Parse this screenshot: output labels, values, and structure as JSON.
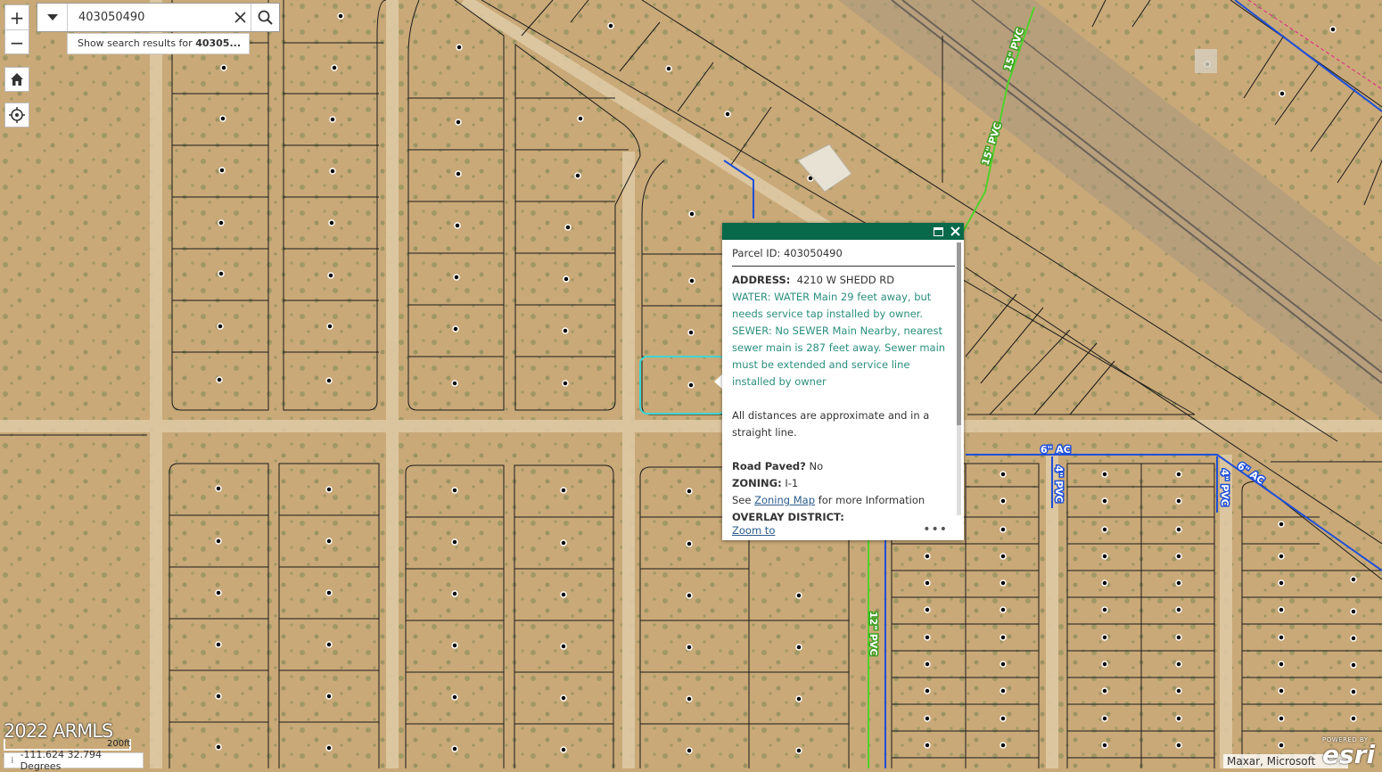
{
  "search": {
    "value": "403050490",
    "suggestion_prefix": "Show search results for ",
    "suggestion_query": "40305..."
  },
  "zoom": {
    "in_label": "+",
    "out_label": "−"
  },
  "icons": {
    "zoom_in": "plus-icon",
    "zoom_out": "minus-icon",
    "home": "home-icon",
    "locate": "locate-icon",
    "dropdown": "caret-down-icon",
    "clear": "close-icon",
    "search": "search-icon",
    "maximize": "maximize-icon",
    "close": "close-icon",
    "more": "more-icon"
  },
  "popup": {
    "title": "Parcel ID: 403050490",
    "address_label": "ADDRESS:",
    "address_value": "4210 W SHEDD RD",
    "water_text": "WATER: WATER Main 29 feet away, but needs service tap installed by owner.",
    "sewer_text": "SEWER: No SEWER Main Nearby, nearest sewer main is 287 feet away. Sewer main must be extended and service line installed by owner",
    "distance_note": "All distances are approximate and in a straight line.",
    "road_paved_label": "Road Paved?",
    "road_paved_value": "No",
    "zoning_label": "ZONING:",
    "zoning_value": "I-1",
    "see_text": "See",
    "zoning_map_link": "Zoning Map",
    "more_info_text": "for more Information",
    "overlay_label": "OVERLAY DISTRICT:",
    "zoom_to_label": "Zoom to",
    "more_label": "•••"
  },
  "map_labels": {
    "pipe_15_a": "15\" PVC",
    "pipe_15_b": "15\" PVC",
    "pipe_6ac_a": "6\" AC",
    "pipe_6ac_b": "6\" AC",
    "pipe_4_a": "4\" PVC",
    "pipe_4_b": "4\" PVC",
    "pipe_12": "12\" PVC"
  },
  "copyright": "2022 ARMLS",
  "scale_label": "200ft",
  "coordinates": "-111.624 32.794 Degrees",
  "attribution": "Maxar, Microsoft",
  "esri": {
    "powered": "POWERED BY",
    "logo": "esri"
  },
  "colors": {
    "popup_header": "#07684a",
    "water_pipe": "#4fd12a",
    "sewer_pipe": "#1f4fd8",
    "selected_parcel": "#3fd6d0",
    "ground": "#c9a978"
  }
}
